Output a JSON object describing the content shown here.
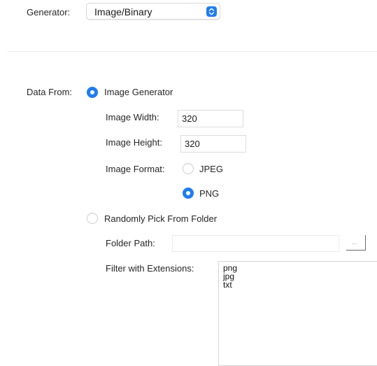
{
  "generator": {
    "label": "Generator:",
    "selected": "Image/Binary"
  },
  "data_from": {
    "label": "Data From:",
    "options": {
      "image_generator": {
        "label": "Image Generator",
        "selected": true
      },
      "random_folder": {
        "label": "Randomly Pick From Folder",
        "selected": false
      }
    }
  },
  "image": {
    "width_label": "Image Width:",
    "width_value": "320",
    "height_label": "Image Height:",
    "height_value": "320",
    "format_label": "Image Format:",
    "formats": {
      "jpeg": {
        "label": "JPEG",
        "selected": false
      },
      "png": {
        "label": "PNG",
        "selected": true
      }
    }
  },
  "folder": {
    "path_label": "Folder Path:",
    "path_value": "",
    "browse_label": "...",
    "filter_label": "Filter with Extensions:",
    "extensions": [
      "png",
      "jpg",
      "txt"
    ]
  },
  "colors": {
    "accent": "#1f7cf2"
  }
}
